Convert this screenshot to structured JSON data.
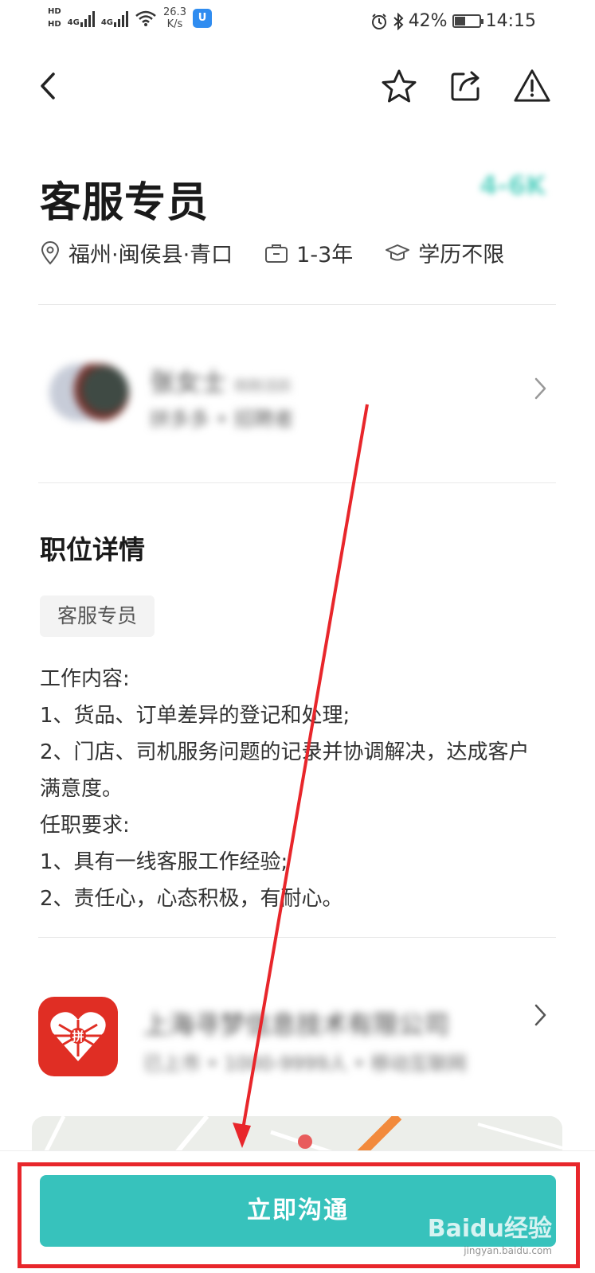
{
  "status_bar": {
    "hd1": "HD",
    "hd2": "HD",
    "net1": "4G",
    "net2": "4G",
    "speed_value": "26.3",
    "speed_unit": "K/s",
    "battery": "42%",
    "battery_level": 0.42,
    "time": "14:15"
  },
  "job": {
    "title": "客服专员",
    "salary": "4-6K",
    "location": "福州·闽侯县·青口",
    "experience": "1-3年",
    "education": "学历不限"
  },
  "recruiter": {
    "name": "张女士",
    "status": "刚刚活跃",
    "sub": "拼多多 • 招聘者"
  },
  "details": {
    "section_title": "职位详情",
    "tag": "客服专员",
    "lines": [
      "工作内容:",
      "1、货品、订单差异的登记和处理;",
      "2、门店、司机服务问题的记录并协调解决，达成客户满意度。",
      "任职要求:",
      "1、具有一线客服工作经验;",
      "2、责任心，心态积极，有耐心。"
    ]
  },
  "company": {
    "name": "上海寻梦信息技术有限公司",
    "sub": "已上市 • 1000-9999人 • 移动互联网",
    "logo_text": "拼"
  },
  "bottom": {
    "chat_button": "立即沟通"
  },
  "watermark": {
    "brand": "Bai",
    "brand2": "du",
    "suffix": "经验",
    "url": "jingyan.baidu.com"
  },
  "colors": {
    "accent": "#37c2bc",
    "highlight": "#e8262b",
    "logo_red": "#e02e24"
  },
  "icons": [
    "back-arrow-icon",
    "star-icon",
    "share-icon",
    "report-warning-icon",
    "location-pin-icon",
    "briefcase-icon",
    "graduation-cap-icon",
    "chevron-right-icon"
  ]
}
